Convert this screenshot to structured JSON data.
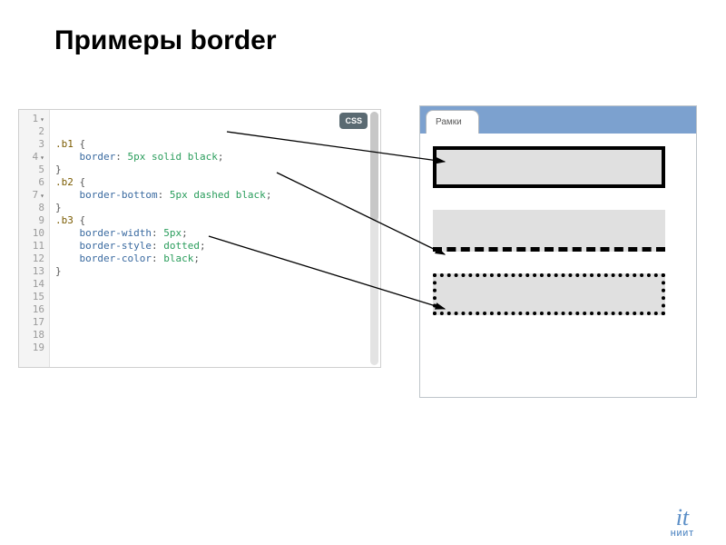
{
  "title": "Примеры border",
  "badge": "CSS",
  "tab_label": "Рамки",
  "logo": {
    "mark": "it",
    "sub": "НИИТ"
  },
  "lines": [
    {
      "n": "1",
      "fold": true
    },
    {
      "n": "2",
      "fold": false
    },
    {
      "n": "3",
      "fold": false
    },
    {
      "n": "4",
      "fold": true
    },
    {
      "n": "5",
      "fold": false
    },
    {
      "n": "6",
      "fold": false
    },
    {
      "n": "7",
      "fold": true
    },
    {
      "n": "8",
      "fold": false
    },
    {
      "n": "9",
      "fold": false
    },
    {
      "n": "10",
      "fold": false
    },
    {
      "n": "11",
      "fold": false
    },
    {
      "n": "12",
      "fold": false
    },
    {
      "n": "13",
      "fold": false
    },
    {
      "n": "14",
      "fold": false
    },
    {
      "n": "15",
      "fold": false
    },
    {
      "n": "16",
      "fold": false
    },
    {
      "n": "17",
      "fold": false
    },
    {
      "n": "18",
      "fold": false
    },
    {
      "n": "19",
      "fold": false
    }
  ],
  "code": {
    "sel_b1": ".b1",
    "sel_b2": ".b2",
    "sel_b3": ".b3",
    "open": "{",
    "close": "}",
    "indent": "    ",
    "colon_sp": ": ",
    "semi": ";",
    "p_border": "border",
    "p_border_bottom": "border-bottom",
    "p_border_width": "border-width",
    "p_border_style": "border-style",
    "p_border_color": "border-color",
    "v_5px_solid_black": "5px solid black",
    "v_5px_dashed_black": "5px dashed black",
    "v_5px": "5px",
    "v_dotted": "dotted",
    "v_black": "black"
  }
}
